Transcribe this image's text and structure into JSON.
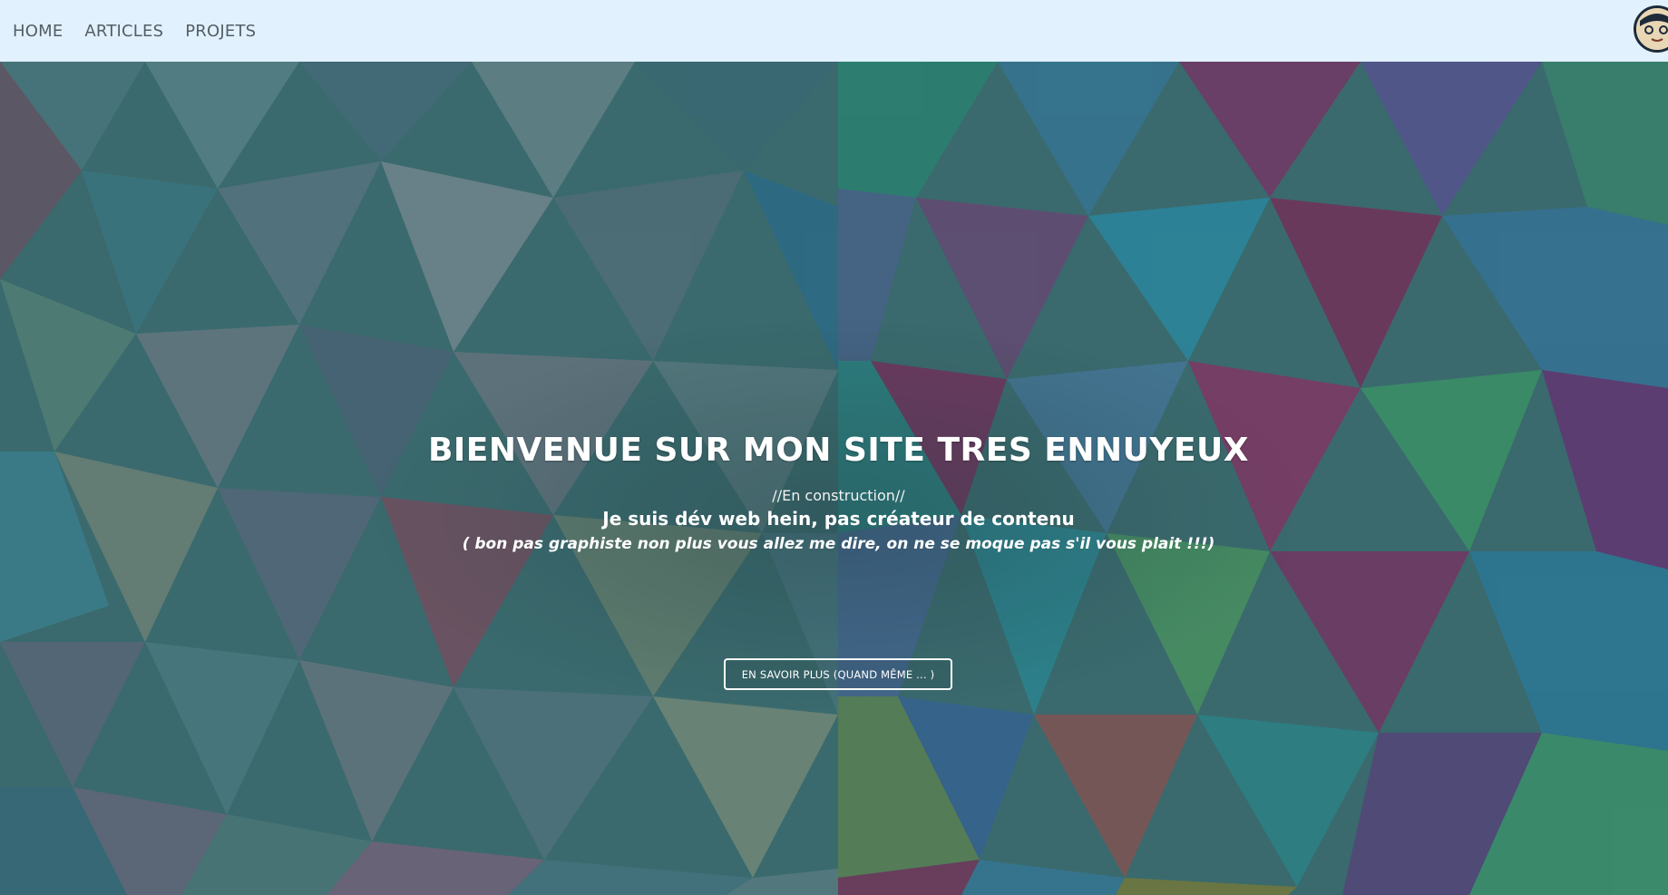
{
  "nav": {
    "items": [
      {
        "label": "HOME"
      },
      {
        "label": "ARTICLES"
      },
      {
        "label": "PROJETS"
      }
    ]
  },
  "hero": {
    "title": "BIENVENUE SUR MON SITE TRES ENNUYEUX",
    "status": "//En construction//",
    "subtitle": "Je suis dév web hein, pas créateur de contenu",
    "note": "( bon pas graphiste non plus vous allez me dire, on ne se moque pas s'il vous plait !!!)",
    "cta_label": "EN SAVOIR PLUS (QUAND MÊME ... )"
  },
  "colors": {
    "navbar_bg": "#e1f1fd",
    "nav_text": "#555e66",
    "hero_text": "#ffffff"
  }
}
